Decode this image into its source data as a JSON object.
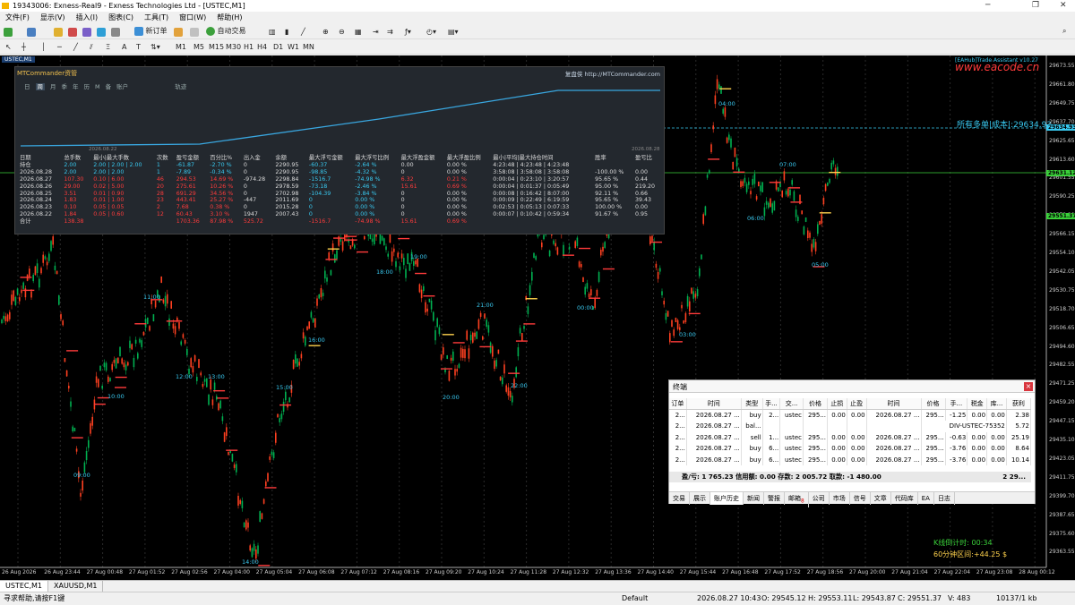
{
  "window": {
    "title": "19343006: Exness-Real9 - Exness Technologies Ltd - [USTEC,M1]"
  },
  "menu": [
    "文件(F)",
    "显示(V)",
    "插入(I)",
    "图表(C)",
    "工具(T)",
    "窗口(W)",
    "帮助(H)"
  ],
  "toolbar": {
    "new_order": "新订单",
    "auto_trade": "自动交易",
    "timeframes": [
      "M1",
      "M5",
      "M15",
      "M30",
      "H1",
      "H4",
      "D1",
      "W1",
      "MN"
    ]
  },
  "chart": {
    "symbol_tab": "USTEC,M1",
    "watermark": "[EAHub]Trade Assistant v10.27",
    "logo": "www.eacode.cn",
    "cost_line": "所有多单|成本|:29634.93",
    "countdown": "K线倒计时: 00:34",
    "range": "60分钟区间:+44.25 $",
    "price_ticks": [
      "29673.55",
      "29661.80",
      "29649.75",
      "29637.70",
      "29625.65",
      "29613.60",
      "29601.55",
      "29590.25",
      "29578.20",
      "29566.15",
      "29554.10",
      "29542.05",
      "29530.75",
      "29518.70",
      "29506.65",
      "29494.60",
      "29482.55",
      "29471.25",
      "29459.20",
      "29447.15",
      "29435.10",
      "29423.05",
      "29411.75",
      "29399.70",
      "29387.65",
      "29375.60",
      "29363.55"
    ],
    "price_badges": [
      "29634.93",
      "29631.12",
      "29551.37"
    ],
    "time_ticks": [
      "26 Aug 2026",
      "26 Aug 23:44",
      "27 Aug 00:48",
      "27 Aug 01:52",
      "27 Aug 02:56",
      "27 Aug 04:00",
      "27 Aug 05:04",
      "27 Aug 06:08",
      "27 Aug 07:12",
      "27 Aug 08:16",
      "27 Aug 09:20",
      "27 Aug 10:24",
      "27 Aug 11:28",
      "27 Aug 12:32",
      "27 Aug 13:36",
      "27 Aug 14:40",
      "27 Aug 15:44",
      "27 Aug 16:48",
      "27 Aug 17:52",
      "27 Aug 18:56",
      "27 Aug 20:00",
      "27 Aug 21:04",
      "27 Aug 22:04",
      "27 Aug 23:08",
      "28 Aug 00:12"
    ],
    "hour_marks": [
      "09:00",
      "10:00",
      "11:00",
      "12:00",
      "13:00",
      "14:00",
      "15:00",
      "16:00",
      "17:00",
      "18:00",
      "19:00",
      "20:00",
      "21:00",
      "22:00",
      "23:00",
      "00:00",
      "01:00",
      "03:00",
      "04:00",
      "06:00",
      "07:00",
      "05:00"
    ]
  },
  "mtc": {
    "header": "MTCommander资管",
    "link": "复盘侠 http://MTCommander.com",
    "tabs": [
      "日",
      "周",
      "月",
      "季",
      "年",
      "历",
      "M",
      "备",
      "账户"
    ],
    "extra_tab": "轨迹",
    "date_left": "2026.08.22",
    "date_right": "2026.08.28",
    "columns": [
      "日期",
      "总手数",
      "最小|最大手数",
      "次数",
      "盈亏金额",
      "百分比%",
      "出入金",
      "余额",
      "最大浮亏金额",
      "最大浮亏比例",
      "最大浮盈金额",
      "最大浮盈比例",
      "最小|平均|最大持仓时间",
      "",
      "胜率",
      "盈亏比"
    ],
    "rows": [
      [
        "持仓",
        "2.00",
        "2.00 | 2.00 | 2.00",
        "1",
        "-61.87",
        "-2.70 %",
        "0",
        "2290.95",
        "-60.37",
        "-2.64 %",
        "0.00",
        "0.00 %",
        "4:23:48 | 4:23:48 | 4:23:48",
        "",
        "",
        ""
      ],
      [
        "2026.08.28",
        "2.00",
        "2.00 | 2.00",
        "1",
        "-7.89",
        "-0.34 %",
        "0",
        "2290.95",
        "-98.85",
        "-4.32 %",
        "0",
        "0.00 %",
        "3:58:08 | 3:58:08 | 3:58:08",
        "",
        "-100.00 %",
        "0.00"
      ],
      [
        "2026.08.27",
        "107.30",
        "0.10 | 6.00",
        "46",
        "294.53",
        "14.69 %",
        "-974.28",
        "2298.84",
        "-1516.7",
        "-74.98 %",
        "6.32",
        "0.21 %",
        "0:00:04 | 0:23:10 | 3:20:57",
        "",
        "95.65 %",
        "0.44"
      ],
      [
        "2026.08.26",
        "29.00",
        "0.02 | 5.00",
        "20",
        "275.61",
        "10.26 %",
        "0",
        "2978.59",
        "-73.18",
        "-2.46 %",
        "15.61",
        "0.69 %",
        "0:00:04 | 0:01:37 | 0:05:49",
        "",
        "95.00 %",
        "219.20"
      ],
      [
        "2026.08.25",
        "3.51",
        "0.01 | 0.90",
        "28",
        "691.29",
        "34.56 %",
        "0",
        "2702.98",
        "-104.39",
        "-3.84 %",
        "0",
        "0.00 %",
        "0:00:08 | 0:16:42 | 8:07:00",
        "",
        "92.11 %",
        "0.66"
      ],
      [
        "2026.08.24",
        "1.83",
        "0.01 | 1.00",
        "23",
        "443.41",
        "25.27 %",
        "-447",
        "2011.69",
        "0",
        "0.00 %",
        "0",
        "0.00 %",
        "0:00:09 | 0:22:49 | 6:19:59",
        "",
        "95.65 %",
        "39.43"
      ],
      [
        "2026.08.23",
        "0.10",
        "0.05 | 0.05",
        "2",
        "7.68",
        "0.38 %",
        "0",
        "2015.28",
        "0",
        "0.00 %",
        "0",
        "0.00 %",
        "0:02:53 | 0:05:13 | 0:07:33",
        "",
        "100.00 %",
        "0.00"
      ],
      [
        "2026.08.22",
        "1.84",
        "0.05 | 0.60",
        "12",
        "60.43",
        "3.10 %",
        "1947",
        "2007.43",
        "0",
        "0.00 %",
        "0",
        "0.00 %",
        "0:00:07 | 0:10:42 | 0:59:34",
        "",
        "91.67 %",
        "0.95"
      ],
      [
        "合计",
        "138.38",
        "",
        "",
        "1703.36",
        "87.98 %",
        "525.72",
        "",
        "-1516.7",
        "-74.98 %",
        "15.61",
        "0.69 %",
        "",
        "",
        "",
        ""
      ]
    ]
  },
  "terminal": {
    "title": "终端",
    "columns": [
      "订单",
      "时间",
      "类型",
      "手...",
      "交...",
      "价格",
      "止损",
      "止盈",
      "时间",
      "价格",
      "手...",
      "税金",
      "库...",
      "获利"
    ],
    "rows": [
      [
        "2...",
        "2026.08.27 ...",
        "buy",
        "2...",
        "ustec",
        "295...",
        "0.00",
        "0.00",
        "2026.08.27 ...",
        "295...",
        "-1.25",
        "0.00",
        "0.00",
        "2.38"
      ],
      [
        "2...",
        "2026.08.27 ...",
        "bal...",
        "",
        "",
        "",
        "",
        "",
        "",
        "DIV-USTEC-75352",
        "",
        "",
        "",
        "5.72"
      ],
      [
        "2...",
        "2026.08.27 ...",
        "sell",
        "1...",
        "ustec",
        "295...",
        "0.00",
        "0.00",
        "2026.08.27 ...",
        "295...",
        "-0.63",
        "0.00",
        "0.00",
        "25.19"
      ],
      [
        "2...",
        "2026.08.27 ...",
        "buy",
        "6...",
        "ustec",
        "295...",
        "0.00",
        "0.00",
        "2026.08.27 ...",
        "295...",
        "-3.76",
        "0.00",
        "0.00",
        "8.64"
      ],
      [
        "2...",
        "2026.08.27 ...",
        "buy",
        "6...",
        "ustec",
        "295...",
        "0.00",
        "0.00",
        "2026.08.27 ...",
        "295...",
        "-3.76",
        "0.00",
        "0.00",
        "10.14"
      ]
    ],
    "summary": "盈/亏: 1 765.23  信用额: 0.00  存款: 2 005.72  取款: -1 480.00",
    "summary_right": "2 29...",
    "tabs": [
      "交易",
      "展示",
      "账户历史",
      "新闻",
      "警报",
      "邮箱",
      "公司",
      "市场",
      "信号",
      "文章",
      "代码库",
      "EA",
      "日志"
    ],
    "mail_count": "8"
  },
  "bottom_tabs": [
    "USTEC,M1",
    "XAUUSD,M1"
  ],
  "status": {
    "help": "寻求帮助,请按F1键",
    "profile": "Default",
    "time": "2026.08.27 10:43",
    "open": "O: 29545.12",
    "high": "H: 29553.11",
    "low": "L: 29543.87",
    "close": "C: 29551.37",
    "volume": "V: 483",
    "traffic": "10137/1 kb"
  },
  "colors": {
    "bull": "#00b050",
    "bear": "#ff4020",
    "cyan": "#39c9f0",
    "yellow": "#ffd24d",
    "red": "#ff3b3b"
  }
}
